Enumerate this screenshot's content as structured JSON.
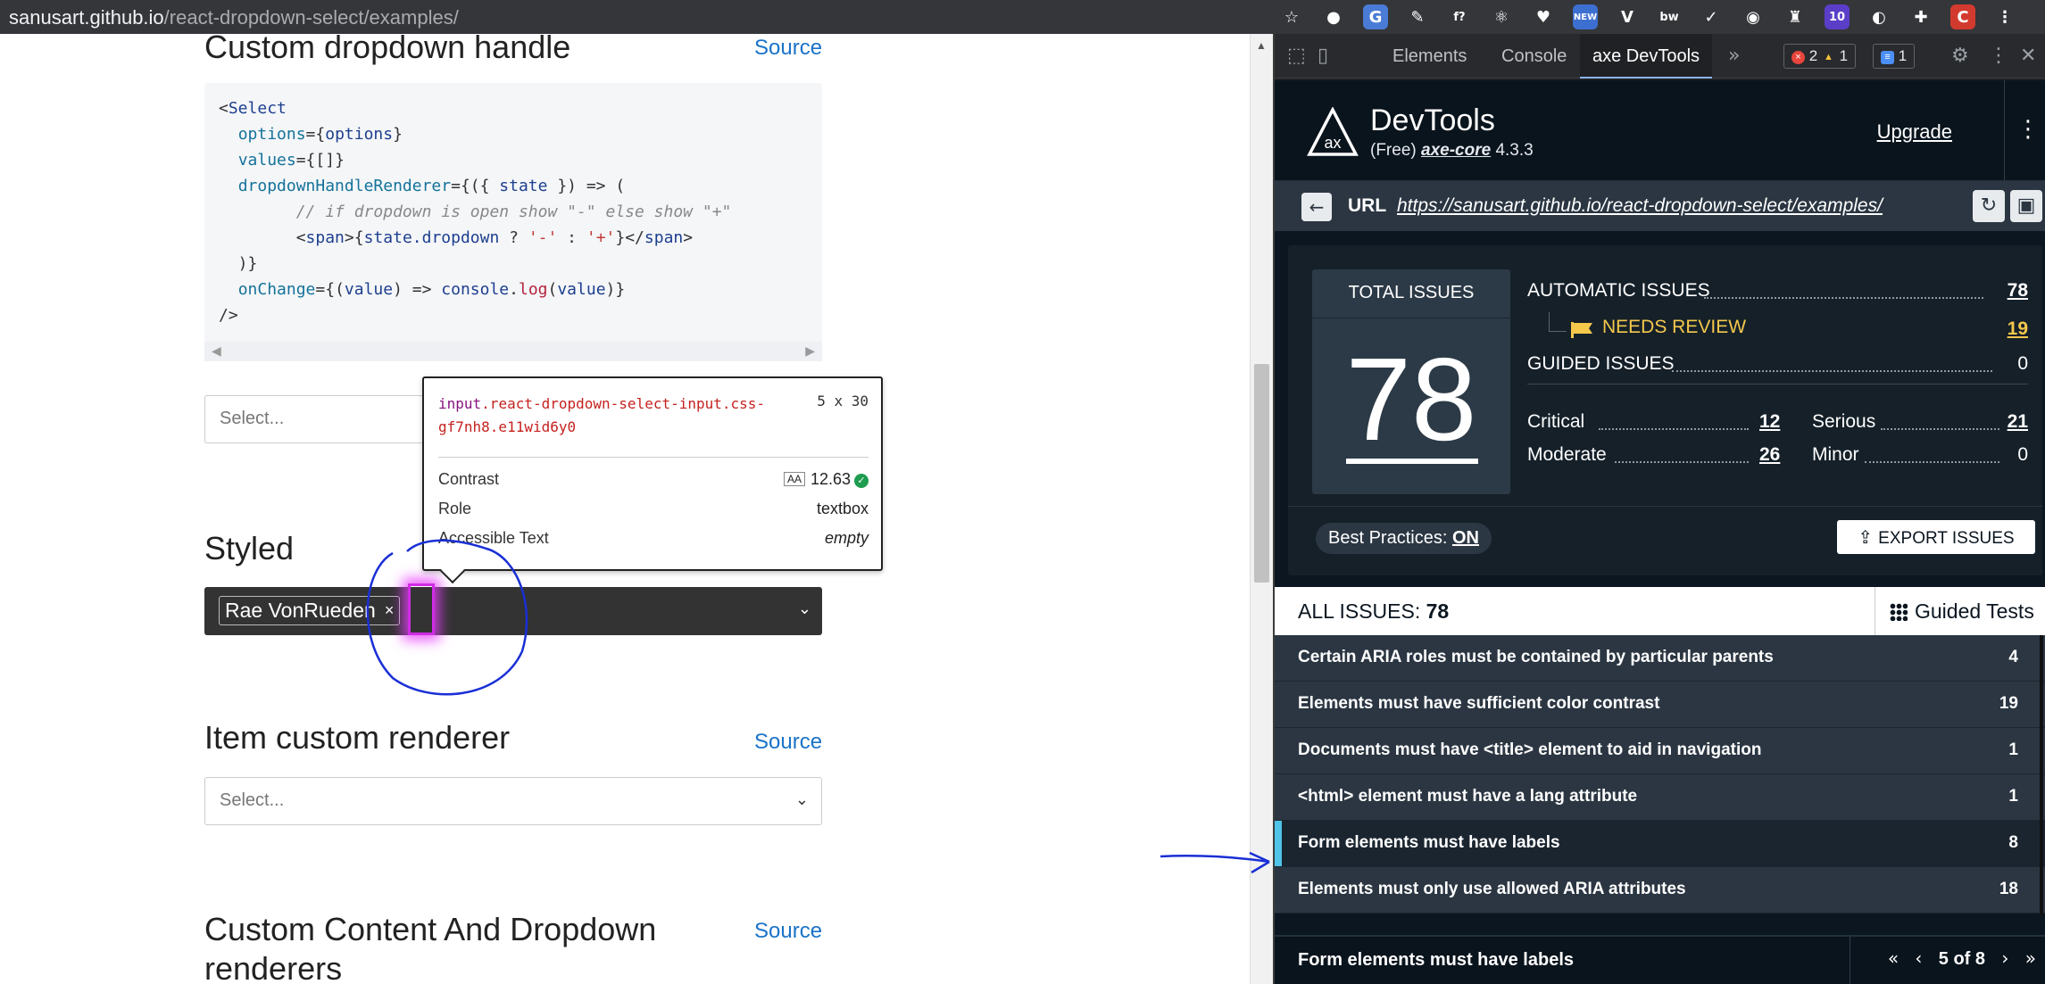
{
  "browser": {
    "host": "sanusart.github.io",
    "path": "/react-dropdown-select/examples/",
    "extensions": [
      {
        "name": "bookmark-star-icon",
        "glyph": "☆",
        "bg": "transparent"
      },
      {
        "name": "extension-circle-icon",
        "glyph": "●",
        "bg": "transparent"
      },
      {
        "name": "google-translate-icon",
        "glyph": "G",
        "bg": "#4a7bd6"
      },
      {
        "name": "eyedropper-icon",
        "glyph": "✎",
        "bg": "transparent"
      },
      {
        "name": "formula-icon",
        "glyph": "f?",
        "bg": "transparent"
      },
      {
        "name": "react-icon",
        "glyph": "⚛",
        "bg": "transparent"
      },
      {
        "name": "pocket-icon",
        "glyph": "♥",
        "bg": "transparent"
      },
      {
        "name": "new-badge-icon",
        "glyph": "NEW",
        "bg": "#3d6fd1"
      },
      {
        "name": "vue-icon",
        "glyph": "V",
        "bg": "transparent"
      },
      {
        "name": "bw-icon",
        "glyph": "bw",
        "bg": "transparent"
      },
      {
        "name": "check-icon",
        "glyph": "✓",
        "bg": "transparent"
      },
      {
        "name": "screenshot-icon",
        "glyph": "◉",
        "bg": "transparent"
      },
      {
        "name": "extension-icon-red",
        "glyph": "♜",
        "bg": "transparent"
      },
      {
        "name": "count-10-icon",
        "glyph": "10",
        "bg": "#5b3ec8"
      },
      {
        "name": "extension-circle-red-icon",
        "glyph": "◐",
        "bg": "transparent"
      },
      {
        "name": "puzzle-icon",
        "glyph": "✚",
        "bg": "transparent"
      },
      {
        "name": "profile-avatar-icon",
        "glyph": "C",
        "bg": "#d33a2f"
      },
      {
        "name": "menu-icon",
        "glyph": "⋮",
        "bg": "transparent"
      }
    ]
  },
  "page": {
    "section_custom_handle": "Custom dropdown handle",
    "source_label": "Source",
    "select_placeholder": "Select...",
    "section_styled": "Styled",
    "styled_chip": "Rae VonRueden",
    "chip_remove": "×",
    "section_item_renderer": "Item custom renderer",
    "section_custom_content": "Custom Content And Dropdown renderers"
  },
  "tooltip": {
    "element": "input",
    "selector_classes": ".react-dropdown-select-input.css-gf7nh8.e11wid6y0",
    "dims": "5 x 30",
    "contrast_label": "Contrast",
    "contrast_badge": "AA",
    "contrast_value": "12.63",
    "role_label": "Role",
    "role_value": "textbox",
    "accessible_text_label": "Accessible Text",
    "accessible_text_value": "empty"
  },
  "devtools": {
    "tabs": [
      "Elements",
      "Console",
      "axe DevTools"
    ],
    "errors": "2",
    "warnings": "1",
    "messages": "1"
  },
  "axe": {
    "title": "DevTools",
    "subtitle_prefix": "(Free) ",
    "subtitle_core": "axe-core",
    "subtitle_version": " 4.3.3",
    "upgrade": "Upgrade",
    "url_label": "URL",
    "url": "https://sanusart.github.io/react-dropdown-select/examples/",
    "total_label": "TOTAL ISSUES",
    "total": "78",
    "automatic_label": "AUTOMATIC ISSUES",
    "automatic": "78",
    "needs_review_label": "NEEDS REVIEW",
    "needs_review": "19",
    "guided_label": "GUIDED ISSUES",
    "guided": "0",
    "critical_label": "Critical",
    "critical": "12",
    "serious_label": "Serious",
    "serious": "21",
    "moderate_label": "Moderate",
    "moderate": "26",
    "minor_label": "Minor",
    "minor": "0",
    "best_practices_label": "Best Practices:",
    "best_practices_value": "ON",
    "export": "EXPORT ISSUES",
    "all_issues_label": "ALL ISSUES:",
    "all_issues_count": "78",
    "guided_tests": "Guided Tests",
    "issues": [
      {
        "title": "Certain ARIA roles must be contained by particular parents",
        "count": "4"
      },
      {
        "title": "Elements must have sufficient color contrast",
        "count": "19"
      },
      {
        "title": "Documents must have <title> element to aid in navigation",
        "count": "1"
      },
      {
        "title": "<html> element must have a lang attribute",
        "count": "1"
      },
      {
        "title": "Form elements must have labels",
        "count": "8"
      },
      {
        "title": "Elements must only use allowed ARIA attributes",
        "count": "18"
      }
    ],
    "footer_title": "Form elements must have labels",
    "pager": "5 of 8"
  },
  "colors": {
    "accent_blue": "#4fc3e8",
    "review_yellow": "#f5c84c",
    "highlight_magenta": "#d02ce5",
    "annotation_ink": "#1a2fd6"
  }
}
